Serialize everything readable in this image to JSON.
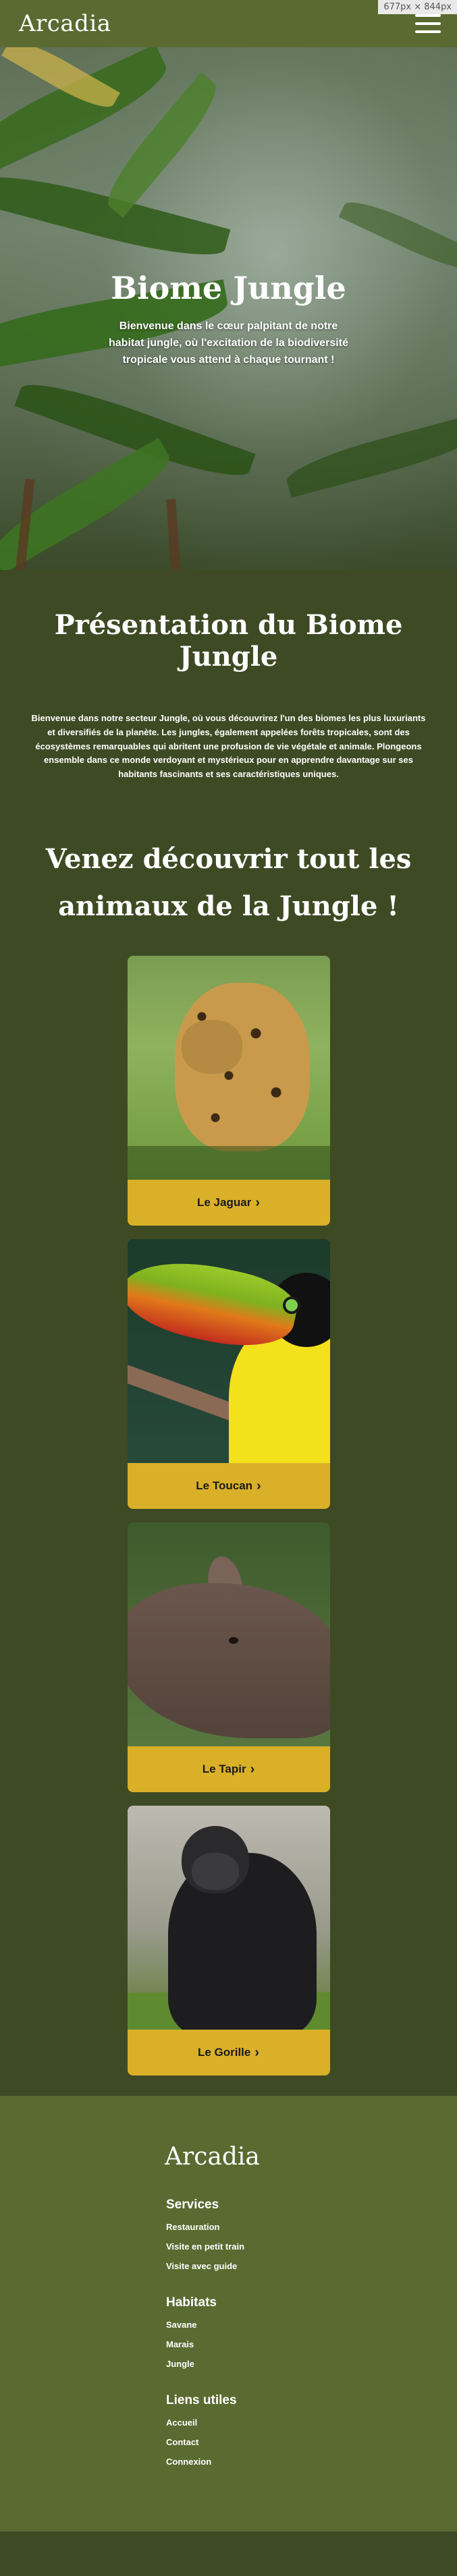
{
  "header": {
    "logo": "Arcadia",
    "menu_icon": "hamburger-menu-icon",
    "size_badge": "677px × 844px"
  },
  "hero": {
    "title": "Biome Jungle",
    "subtitle": "Bienvenue dans le cœur palpitant de notre habitat jungle, où l'excitation de la biodiversité tropicale vous attend à chaque tournant !"
  },
  "presentation": {
    "title": "Présentation du Biome Jungle",
    "text": "Bienvenue dans notre secteur Jungle, où vous découvrirez l'un des biomes les plus luxuriants et diversifiés de la planète. Les jungles, également appelées forêts tropicales, sont des écosystèmes remarquables qui abritent une profusion de vie végétale et animale. Plongeons ensemble dans ce monde verdoyant et mystérieux pour en apprendre davantage sur ses habitants fascinants et ses caractéristiques uniques."
  },
  "discover": {
    "title": "Venez découvrir tout les animaux de la Jungle !"
  },
  "animals": [
    {
      "label": "Le Jaguar",
      "icon": "chevron-right-icon"
    },
    {
      "label": "Le Toucan",
      "icon": "chevron-right-icon"
    },
    {
      "label": "Le Tapir",
      "icon": "chevron-right-icon"
    },
    {
      "label": "Le Gorille",
      "icon": "chevron-right-icon"
    }
  ],
  "footer": {
    "logo": "Arcadia",
    "sections": [
      {
        "title": "Services",
        "links": [
          "Restauration",
          "Visite en petit train",
          "Visite avec guide"
        ]
      },
      {
        "title": "Habitats",
        "links": [
          "Savane",
          "Marais",
          "Jungle"
        ]
      },
      {
        "title": "Liens utiles",
        "links": [
          "Accueil",
          "Contact",
          "Connexion"
        ]
      }
    ]
  },
  "colors": {
    "header_bg": "#5a6a31",
    "page_bg": "#3e4a24",
    "card_button": "#d9b028"
  }
}
